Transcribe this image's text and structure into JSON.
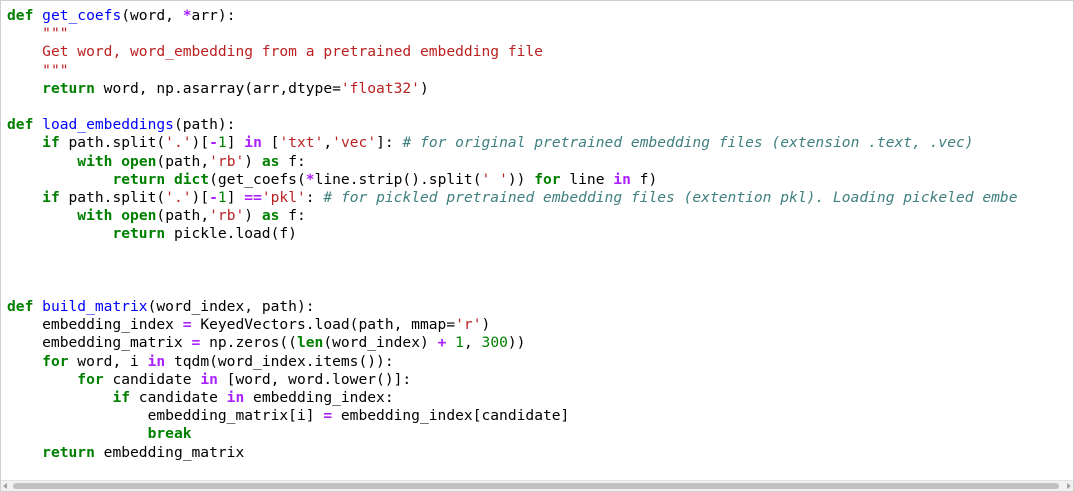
{
  "code": {
    "lines": [
      [
        {
          "t": "def",
          "c": "kw"
        },
        {
          "t": " "
        },
        {
          "t": "get_coefs",
          "c": "fn"
        },
        {
          "t": "(word, "
        },
        {
          "t": "*",
          "c": "op"
        },
        {
          "t": "arr):"
        }
      ],
      [
        {
          "t": "    "
        },
        {
          "t": "\"\"\"",
          "c": "str"
        }
      ],
      [
        {
          "t": "    "
        },
        {
          "t": "Get word, word_embedding from a pretrained embedding file",
          "c": "str"
        }
      ],
      [
        {
          "t": "    "
        },
        {
          "t": "\"\"\"",
          "c": "str"
        }
      ],
      [
        {
          "t": "    "
        },
        {
          "t": "return",
          "c": "kw"
        },
        {
          "t": " word, np.asarray(arr,dtype="
        },
        {
          "t": "'float32'",
          "c": "str"
        },
        {
          "t": ")"
        }
      ],
      [],
      [
        {
          "t": "def",
          "c": "kw"
        },
        {
          "t": " "
        },
        {
          "t": "load_embeddings",
          "c": "fn"
        },
        {
          "t": "(path):"
        }
      ],
      [
        {
          "t": "    "
        },
        {
          "t": "if",
          "c": "kw"
        },
        {
          "t": " path.split("
        },
        {
          "t": "'.'",
          "c": "str"
        },
        {
          "t": ")["
        },
        {
          "t": "-",
          "c": "op"
        },
        {
          "t": "1",
          "c": "num"
        },
        {
          "t": "] "
        },
        {
          "t": "in",
          "c": "op"
        },
        {
          "t": " ["
        },
        {
          "t": "'txt'",
          "c": "str"
        },
        {
          "t": ","
        },
        {
          "t": "'vec'",
          "c": "str"
        },
        {
          "t": "]: "
        },
        {
          "t": "# for original pretrained embedding files (extension .text, .vec)",
          "c": "cm"
        }
      ],
      [
        {
          "t": "        "
        },
        {
          "t": "with",
          "c": "kw"
        },
        {
          "t": " "
        },
        {
          "t": "open",
          "c": "kw"
        },
        {
          "t": "(path,"
        },
        {
          "t": "'rb'",
          "c": "str"
        },
        {
          "t": ") "
        },
        {
          "t": "as",
          "c": "kw"
        },
        {
          "t": " f:"
        }
      ],
      [
        {
          "t": "            "
        },
        {
          "t": "return",
          "c": "kw"
        },
        {
          "t": " "
        },
        {
          "t": "dict",
          "c": "kw"
        },
        {
          "t": "(get_coefs("
        },
        {
          "t": "*",
          "c": "op"
        },
        {
          "t": "line.strip().split("
        },
        {
          "t": "' '",
          "c": "str"
        },
        {
          "t": ")) "
        },
        {
          "t": "for",
          "c": "kw"
        },
        {
          "t": " line "
        },
        {
          "t": "in",
          "c": "op"
        },
        {
          "t": " f)"
        }
      ],
      [
        {
          "t": "    "
        },
        {
          "t": "if",
          "c": "kw"
        },
        {
          "t": " path.split("
        },
        {
          "t": "'.'",
          "c": "str"
        },
        {
          "t": ")["
        },
        {
          "t": "-",
          "c": "op"
        },
        {
          "t": "1",
          "c": "num"
        },
        {
          "t": "] "
        },
        {
          "t": "==",
          "c": "op"
        },
        {
          "t": "'pkl'",
          "c": "str"
        },
        {
          "t": ": "
        },
        {
          "t": "# for pickled pretrained embedding files (extention pkl). Loading pickeled embe",
          "c": "cm"
        }
      ],
      [
        {
          "t": "        "
        },
        {
          "t": "with",
          "c": "kw"
        },
        {
          "t": " "
        },
        {
          "t": "open",
          "c": "kw"
        },
        {
          "t": "(path,"
        },
        {
          "t": "'rb'",
          "c": "str"
        },
        {
          "t": ") "
        },
        {
          "t": "as",
          "c": "kw"
        },
        {
          "t": " f:"
        }
      ],
      [
        {
          "t": "            "
        },
        {
          "t": "return",
          "c": "kw"
        },
        {
          "t": " pickle.load(f)"
        }
      ],
      [],
      [],
      [],
      [
        {
          "t": "def",
          "c": "kw"
        },
        {
          "t": " "
        },
        {
          "t": "build_matrix",
          "c": "fn"
        },
        {
          "t": "(word_index, path):"
        }
      ],
      [
        {
          "t": "    embedding_index "
        },
        {
          "t": "=",
          "c": "op"
        },
        {
          "t": " KeyedVectors.load(path, mmap="
        },
        {
          "t": "'r'",
          "c": "str"
        },
        {
          "t": ")"
        }
      ],
      [
        {
          "t": "    embedding_matrix "
        },
        {
          "t": "=",
          "c": "op"
        },
        {
          "t": " np.zeros(("
        },
        {
          "t": "len",
          "c": "kw"
        },
        {
          "t": "(word_index) "
        },
        {
          "t": "+",
          "c": "op"
        },
        {
          "t": " "
        },
        {
          "t": "1",
          "c": "num"
        },
        {
          "t": ", "
        },
        {
          "t": "300",
          "c": "num"
        },
        {
          "t": "))"
        }
      ],
      [
        {
          "t": "    "
        },
        {
          "t": "for",
          "c": "kw"
        },
        {
          "t": " word, i "
        },
        {
          "t": "in",
          "c": "op"
        },
        {
          "t": " tqdm(word_index.items()):"
        }
      ],
      [
        {
          "t": "        "
        },
        {
          "t": "for",
          "c": "kw"
        },
        {
          "t": " candidate "
        },
        {
          "t": "in",
          "c": "op"
        },
        {
          "t": " [word, word.lower()]:"
        }
      ],
      [
        {
          "t": "            "
        },
        {
          "t": "if",
          "c": "kw"
        },
        {
          "t": " candidate "
        },
        {
          "t": "in",
          "c": "op"
        },
        {
          "t": " embedding_index:"
        }
      ],
      [
        {
          "t": "                embedding_matrix[i] "
        },
        {
          "t": "=",
          "c": "op"
        },
        {
          "t": " embedding_index[candidate]"
        }
      ],
      [
        {
          "t": "                "
        },
        {
          "t": "break",
          "c": "kw"
        }
      ],
      [
        {
          "t": "    "
        },
        {
          "t": "return",
          "c": "kw"
        },
        {
          "t": " embedding_matrix"
        }
      ]
    ]
  },
  "scrollbar": {
    "left_arrow_icon": "triangle-left-icon",
    "right_arrow_icon": "triangle-right-icon"
  }
}
